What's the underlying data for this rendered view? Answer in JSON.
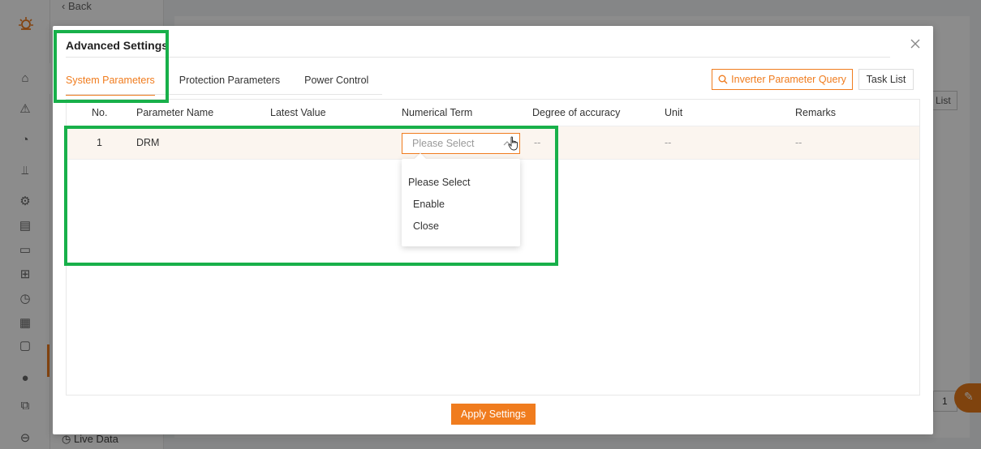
{
  "background": {
    "back_label": "Back",
    "live_data_label": "Live Data",
    "list_button_label": "List",
    "pager_value": "1"
  },
  "modal": {
    "title": "Advanced Settings",
    "tabs": [
      {
        "label": "System Parameters",
        "active": true
      },
      {
        "label": "Protection Parameters",
        "active": false
      },
      {
        "label": "Power Control",
        "active": false
      }
    ],
    "query_button_label": "Inverter Parameter Query",
    "task_list_label": "Task List",
    "apply_button_label": "Apply Settings"
  },
  "table": {
    "columns": [
      "No.",
      "Parameter Name",
      "Latest Value",
      "Numerical Term",
      "Degree of accuracy",
      "Unit",
      "Remarks"
    ],
    "rows": [
      {
        "no": "1",
        "name": "DRM",
        "latest": "",
        "select_placeholder": "Please Select",
        "accuracy": "--",
        "unit": "--",
        "remarks": "--"
      }
    ]
  },
  "dropdown": {
    "options": [
      "Please Select",
      "Enable",
      "Close"
    ]
  },
  "colors": {
    "accent": "#f07c1e",
    "highlight": "#18b04a"
  }
}
